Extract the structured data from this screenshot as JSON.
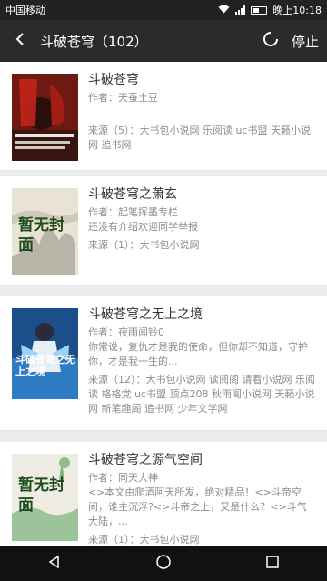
{
  "status": {
    "carrier": "中国移动",
    "time": "晚上10:18"
  },
  "appbar": {
    "title": "斗破苍穹（102）",
    "stop_label": "停止"
  },
  "books": [
    {
      "title": "斗破苍穹",
      "author": "作者：天蚕土豆",
      "description": "",
      "sources": "来源（5）：大书包小说网 乐阅读 uc书盟 天籁小说网 追书网",
      "cover": {
        "style": "red-dark",
        "text": ""
      }
    },
    {
      "title": "斗破苍穹之萧玄",
      "author": "作者：起笔挥墨专栏",
      "description": "还没有介绍欢迎同学举报",
      "sources": "来源（1）：大书包小说网",
      "cover": {
        "style": "placeholder",
        "text": "暂无封面"
      }
    },
    {
      "title": "斗破苍穹之无上之境",
      "author": "作者：夜雨闻铃0",
      "description": "你常说，复仇才是我的使命，但你却不知道，守护你，才是我一生的...",
      "sources": "来源（12）：大书包小说网 读阅阁 请看小说网 乐阅读 格格党 uc书盟 顶点208 秋雨阁小说网 天籁小说网 新笔趣阁 追书网 少年文学网",
      "cover": {
        "style": "blue-anime",
        "text": "斗破苍穹之无上之境"
      }
    },
    {
      "title": "斗破苍穹之源气空间",
      "author": "作者：同天大神",
      "description": "<>本文由爬酒阿天所发，绝对精品！<>斗帝空间，谁主沉浮?<>斗帝之上，又是什么？<>斗气大陆，...",
      "sources": "来源（1）：大书包小说网",
      "cover": {
        "style": "placeholder-green",
        "text": "暂无封面"
      }
    }
  ],
  "colors": {
    "appbar": "#2b2b2b",
    "statusbar": "#222222",
    "text_primary": "#333333",
    "text_secondary": "#8e8e8e"
  }
}
